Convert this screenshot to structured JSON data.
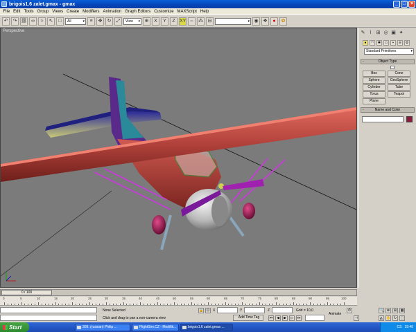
{
  "window": {
    "title": "brigois1.6 zalet.gmax - gmax"
  },
  "menu": [
    "File",
    "Edit",
    "Tools",
    "Group",
    "Views",
    "Create",
    "Modifiers",
    "Animation",
    "Graph Editors",
    "Customize",
    "MAXScript",
    "Help"
  ],
  "toolbar": {
    "selection_filter": "All",
    "coord_system": "View"
  },
  "viewport": {
    "label": "Perspective"
  },
  "command_panel": {
    "category_dropdown": "Standard Primitives",
    "object_type_title": "Object Type",
    "buttons": [
      "Box",
      "Cone",
      "Sphere",
      "GeoSphere",
      "Cylinder",
      "Tube",
      "Torus",
      "Teapot",
      "Plane"
    ],
    "name_color_title": "Name and Color",
    "swatch_color": "#8a1b3c"
  },
  "timeline": {
    "slider_label": "0 / 100",
    "ticks": [
      "0",
      "5",
      "10",
      "15",
      "20",
      "25",
      "30",
      "35",
      "40",
      "45",
      "50",
      "55",
      "60",
      "65",
      "70",
      "75",
      "80",
      "85",
      "90",
      "95",
      "100"
    ]
  },
  "status": {
    "selection": "None Selected",
    "prompt": "Click and drag to pan a non-camera view",
    "x_label": "X",
    "y_label": "Y",
    "z_label": "Z",
    "grid": "Grid = 10,0",
    "add_time_tag": "Add Time Tag",
    "animate": "Animate"
  },
  "taskbar": {
    "start": "Start",
    "tasks": [
      "309. (russian) Philip ...",
      "FlightSim.CZ - Modifik...",
      "brigois1.6 zalet.gmax ..."
    ],
    "lang": "CS",
    "clock": "19:46"
  }
}
